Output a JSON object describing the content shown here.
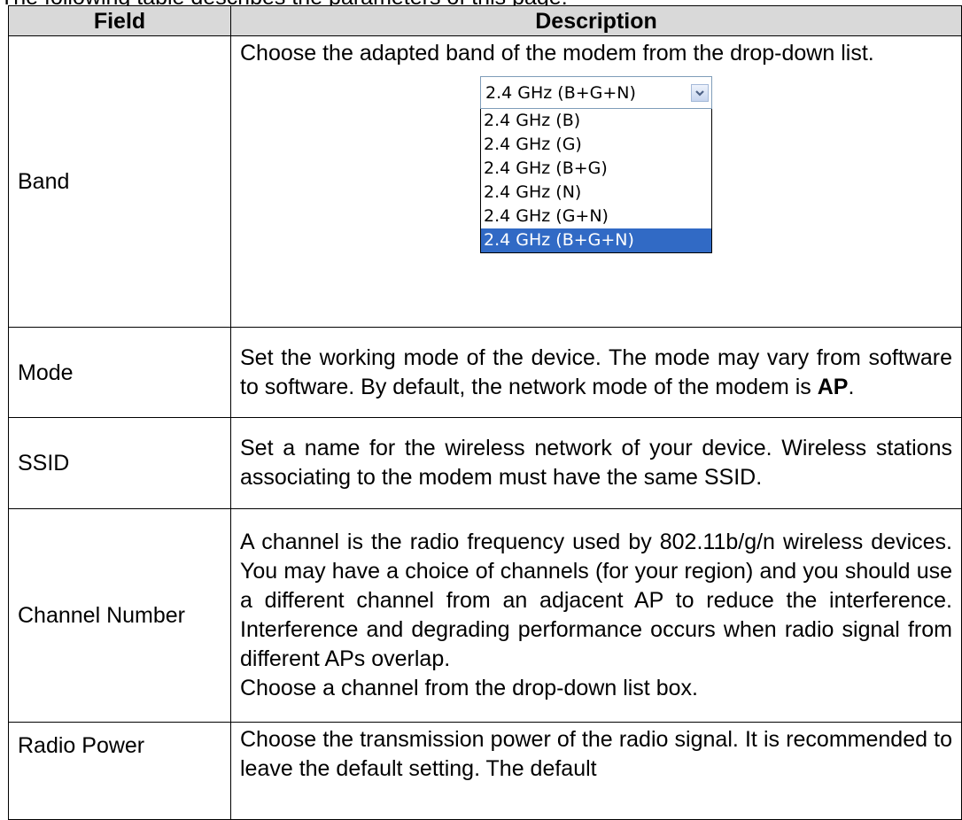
{
  "intro_text": "The following table describes the parameters of this page:",
  "table": {
    "header": {
      "field": "Field",
      "description": "Description"
    },
    "rows": {
      "band": {
        "field": "Band",
        "description": "Choose the adapted band of the modem from the drop-down list.",
        "dropdown": {
          "selected": "2.4 GHz (B+G+N)",
          "options": [
            "2.4 GHz (B)",
            "2.4 GHz (G)",
            "2.4 GHz (B+G)",
            "2.4 GHz (N)",
            "2.4 GHz (G+N)",
            "2.4 GHz (B+G+N)"
          ],
          "highlighted_option": "2.4 GHz (B+G+N)"
        }
      },
      "mode": {
        "field": "Mode",
        "description_prefix": "Set the working mode of the device. The mode may vary from software to software. By default, the network mode of the modem is ",
        "description_bold": "AP",
        "description_suffix": "."
      },
      "ssid": {
        "field": "SSID",
        "description": "Set a name for the wireless network of your device. Wireless stations associating to the modem must have the same SSID."
      },
      "channel_number": {
        "field": "Channel Number",
        "description": "A channel is the radio frequency used by 802.11b/g/n wireless devices. You may have a choice of channels (for your region) and you should use a different channel from an adjacent AP to reduce the interference. Interference and degrading performance occurs when radio signal from different APs overlap.",
        "description_2": "Choose a channel from the drop-down list box."
      },
      "radio_power": {
        "field": "Radio Power",
        "description": "Choose the transmission power of the radio signal. It is recommended to leave the default setting. The default"
      }
    }
  },
  "colors": {
    "header_bg": "#d9d9d9",
    "selection_bg": "#316ac5",
    "select_border": "#7f9db9"
  },
  "icons": {
    "dropdown_arrow": "chevron-down-icon"
  }
}
